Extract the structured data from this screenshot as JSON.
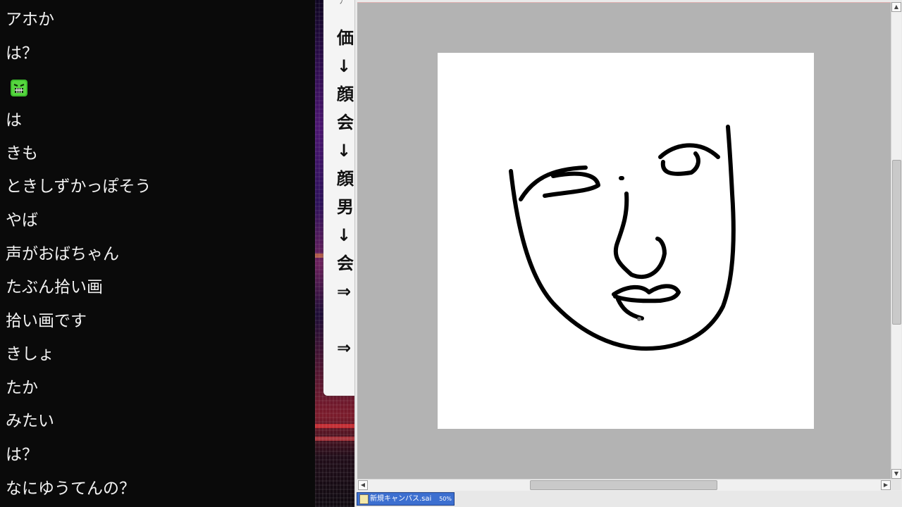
{
  "chat": {
    "messages": [
      "アホか",
      "は？",
      "",
      "は",
      "きも",
      "ときしずかっぽそう",
      "やば",
      "声がおばちゃん",
      "たぶん拾い画",
      "拾い画です",
      "きしょ",
      "たか",
      "みたい",
      "は？",
      "なにゆうてんの？"
    ],
    "emote_icon": "green-angry-face-emote-icon"
  },
  "memo": {
    "top_fragment": "ﾌ",
    "lines": [
      "価",
      "↓",
      "顔",
      "会",
      "↓",
      "顔",
      "男",
      "↓",
      "会",
      "⇒",
      "",
      "⇒"
    ]
  },
  "sai": {
    "document_tab": {
      "name": "新規キャンバス.sai",
      "zoom": "50%"
    }
  },
  "colors": {
    "chat_bg": "#0a0a0a",
    "chat_text": "#f2f2f2",
    "canvas_bg": "#b3b3b3",
    "paper": "#ffffff",
    "tab_active": "#3c6fd0"
  }
}
